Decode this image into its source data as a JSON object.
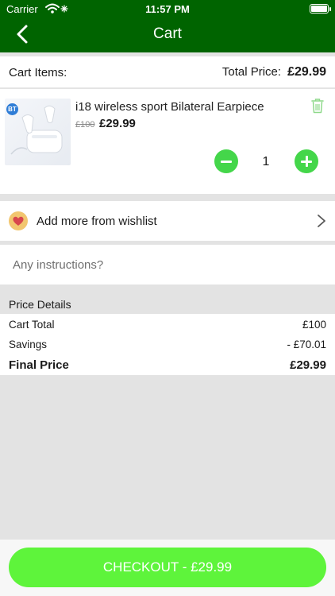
{
  "status_bar": {
    "carrier": "Carrier",
    "time": "11:57 PM"
  },
  "header": {
    "title": "Cart"
  },
  "summary": {
    "items_label": "Cart Items:",
    "total_label": "Total Price:",
    "total_value": "£29.99"
  },
  "cart_items": [
    {
      "name": "i18 wireless sport Bilateral Earpiece",
      "image_badge": "BT",
      "old_price": "£100",
      "price": "£29.99",
      "quantity": "1"
    }
  ],
  "wishlist": {
    "label": "Add more from wishlist"
  },
  "instructions": {
    "placeholder": "Any instructions?"
  },
  "price_details": {
    "heading": "Price Details",
    "rows": [
      {
        "label": "Cart Total",
        "value": "£100"
      },
      {
        "label": "Savings",
        "value": "- £70.01"
      },
      {
        "label": "Final Price",
        "value": "£29.99"
      }
    ]
  },
  "checkout": {
    "label": "CHECKOUT - £29.99"
  },
  "colors": {
    "header": "#006400",
    "accent_green": "#44d64a",
    "checkout_green": "#5ef43b"
  },
  "icons": [
    "back-chevron-icon",
    "trash-icon",
    "minus-icon",
    "plus-icon",
    "heart-icon",
    "chevron-right-icon",
    "wifi-icon",
    "battery-icon"
  ]
}
